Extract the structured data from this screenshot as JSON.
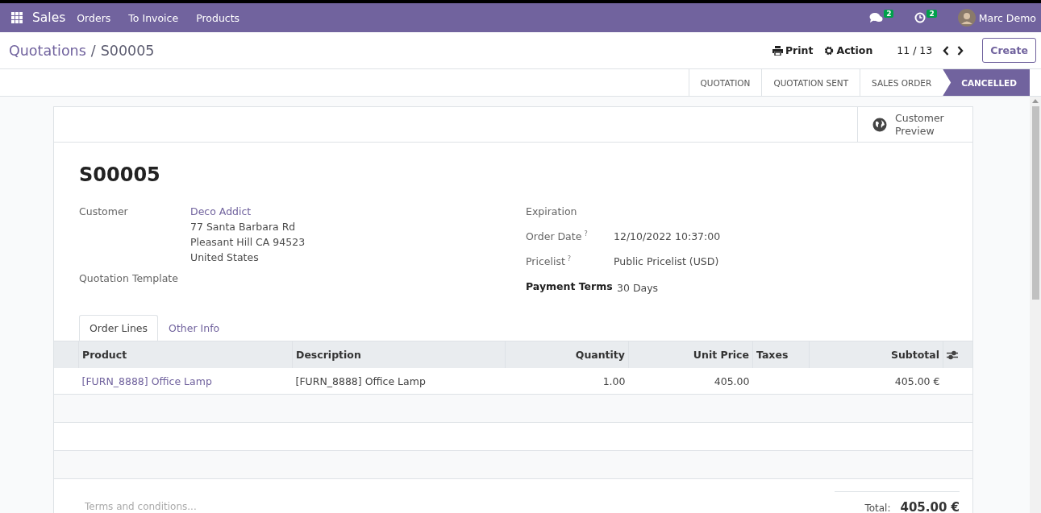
{
  "navbar": {
    "app": "Sales",
    "menus": [
      "Orders",
      "To Invoice",
      "Products"
    ],
    "messages_count": "2",
    "activities_count": "2",
    "user": "Marc Demo"
  },
  "control_panel": {
    "breadcrumb_separator": "/",
    "breadcrumb": [
      {
        "label": "Quotations",
        "kind": "link"
      },
      {
        "label": "S00005",
        "kind": "current"
      }
    ],
    "print": "Print",
    "action": "Action",
    "pager": "11 / 13",
    "create": "Create"
  },
  "status_steps": [
    {
      "label": "QUOTATION",
      "selected": false
    },
    {
      "label": "QUOTATION SENT",
      "selected": false
    },
    {
      "label": "SALES ORDER",
      "selected": false
    },
    {
      "label": "CANCELLED",
      "selected": true
    }
  ],
  "button_box": {
    "customer_preview": "Customer Preview"
  },
  "title": "S00005",
  "left_fields": [
    {
      "label": "Customer",
      "link": "Deco Addict",
      "lines": [
        "77 Santa Barbara Rd",
        "Pleasant Hill CA 94523",
        "United States"
      ]
    },
    {
      "label": "Quotation Template"
    }
  ],
  "right_fields": [
    {
      "label": "Expiration",
      "bold": false
    },
    {
      "label": "Order Date",
      "help_mark": "?",
      "bold": false,
      "value": "12/10/2022 10:37:00"
    },
    {
      "label": "Pricelist",
      "help_mark": "?",
      "bold": false,
      "value": "Public Pricelist (USD)"
    },
    {
      "label": "Payment Terms",
      "bold": true,
      "value": "30 Days"
    }
  ],
  "tabs": [
    {
      "label": "Order Lines",
      "selected": true
    },
    {
      "label": "Other Info",
      "selected": false
    }
  ],
  "table": {
    "columns": [
      "Product",
      "Description",
      "Quantity",
      "Unit Price",
      "Taxes",
      "Subtotal"
    ],
    "rows": [
      [
        "[FURN_8888] Office Lamp",
        "[FURN_8888] Office Lamp",
        "1.00",
        "405.00",
        "",
        "405.00 €"
      ]
    ]
  },
  "terms_placeholder": "Terms and conditions...",
  "total": {
    "label": "Total:",
    "value": "405.00 €"
  }
}
